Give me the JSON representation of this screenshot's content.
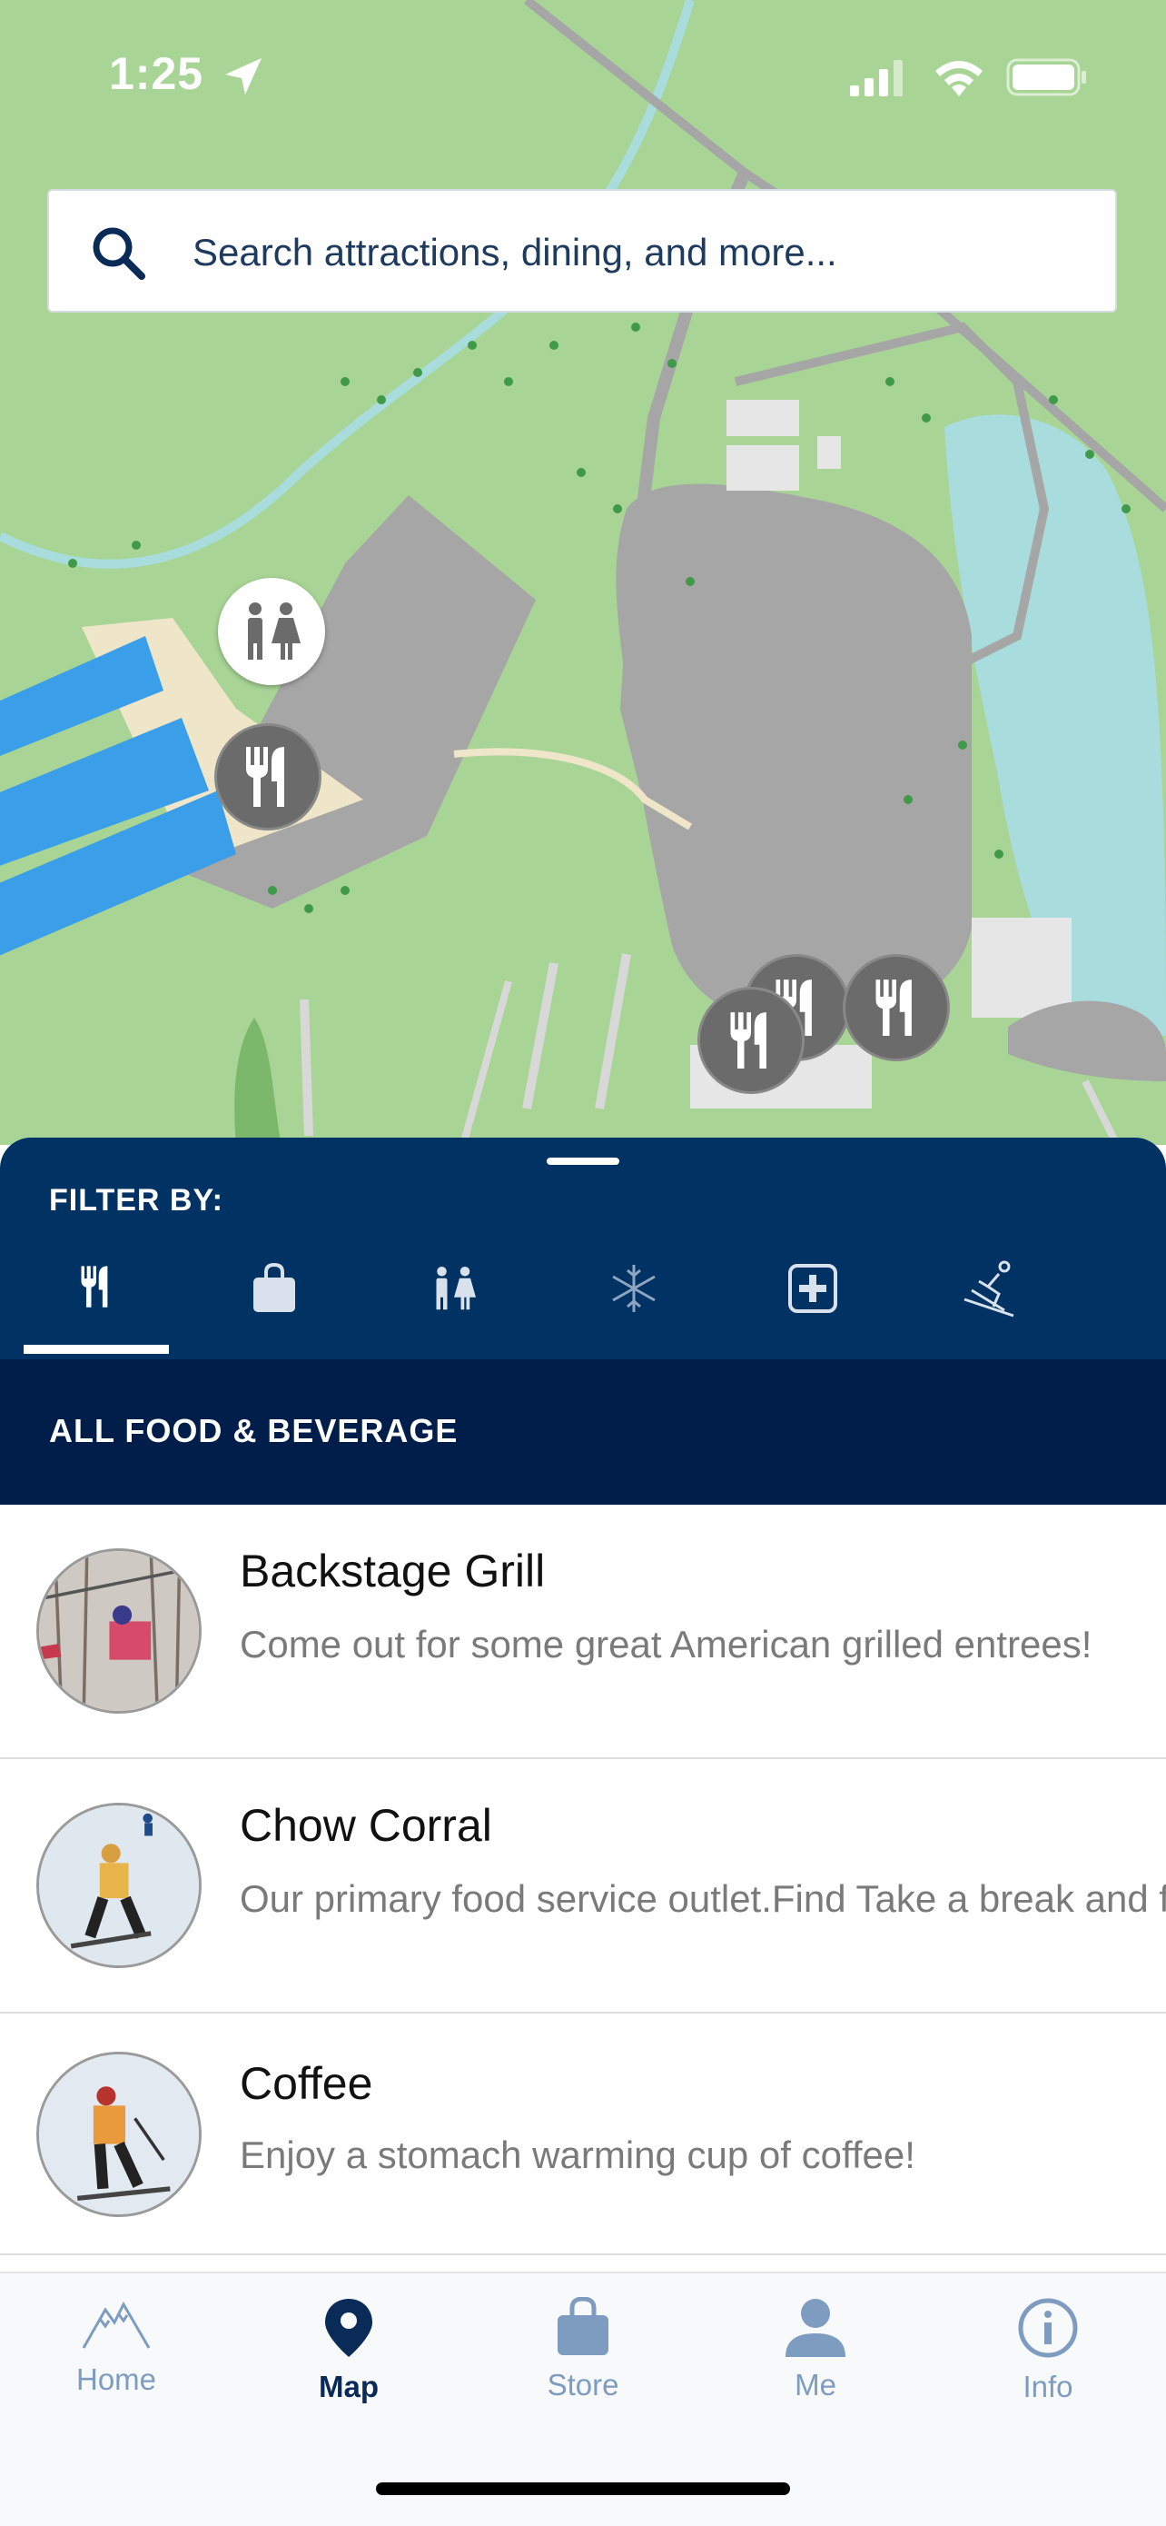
{
  "status_bar": {
    "time": "1:25"
  },
  "search": {
    "placeholder": "Search attractions, dining, and more..."
  },
  "sheet": {
    "filter_label": "FILTER BY:",
    "filters": [
      {
        "icon": "fork-knife-icon",
        "active": true
      },
      {
        "icon": "shopping-bag-icon",
        "active": false
      },
      {
        "icon": "restroom-icon",
        "active": false
      },
      {
        "icon": "snowflake-icon",
        "active": false
      },
      {
        "icon": "first-aid-icon",
        "active": false
      },
      {
        "icon": "skier-icon",
        "active": false
      },
      {
        "icon": "more-icon",
        "active": false
      }
    ],
    "category_title": "ALL FOOD & BEVERAGE",
    "items": [
      {
        "name": "Backstage Grill",
        "description": "Come out for some great American grilled entrees!"
      },
      {
        "name": "Chow Corral",
        "description": "Our primary food service outlet.Find Take a break and find a variety of items in our cafet..."
      },
      {
        "name": "Coffee",
        "description": "Enjoy a stomach warming cup of coffee!"
      }
    ]
  },
  "tab_bar": {
    "items": [
      {
        "label": "Home",
        "icon": "mountain-icon",
        "active": false
      },
      {
        "label": "Map",
        "icon": "map-pin-icon",
        "active": true
      },
      {
        "label": "Store",
        "icon": "shopping-bag-icon",
        "active": false
      },
      {
        "label": "Me",
        "icon": "person-icon",
        "active": false
      },
      {
        "label": "Info",
        "icon": "info-icon",
        "active": false
      }
    ]
  },
  "colors": {
    "sheet_header": "#003263",
    "category_bar": "#011e4a",
    "map_grass": "#a8d595",
    "map_water": "#a9dcdc",
    "lift_blue": "#3a9ee8",
    "active_tab": "#0a2a57",
    "inactive_tab": "#7d9cc0"
  }
}
